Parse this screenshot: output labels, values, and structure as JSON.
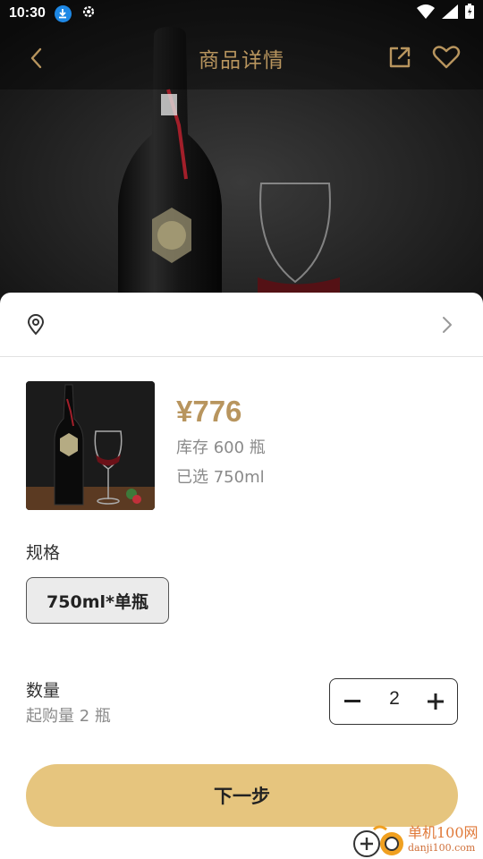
{
  "status_bar": {
    "time": "10:30",
    "icons": [
      "download-icon",
      "gear-icon",
      "wifi-icon",
      "signal-icon",
      "battery-icon"
    ]
  },
  "nav": {
    "title": "商品详情",
    "back_icon": "chevron-left-icon",
    "share_icon": "share-icon",
    "favorite_icon": "heart-icon"
  },
  "address": {
    "icon": "location-pin-icon",
    "text": "",
    "chevron_icon": "chevron-right-icon"
  },
  "product": {
    "price": "¥776",
    "stock": "库存 600 瓶",
    "selected": "已选 750ml"
  },
  "spec": {
    "label": "规格",
    "options": [
      "750ml*单瓶"
    ]
  },
  "quantity": {
    "label": "数量",
    "min_note": "起购量 2 瓶",
    "value": "2"
  },
  "next_button": "下一步",
  "watermark": {
    "cn": "单机100网",
    "url": "danji100.com"
  },
  "colors": {
    "accent_gold": "#b8955e",
    "button_gold": "#e6c57e",
    "muted_text": "#8a8a8a"
  }
}
